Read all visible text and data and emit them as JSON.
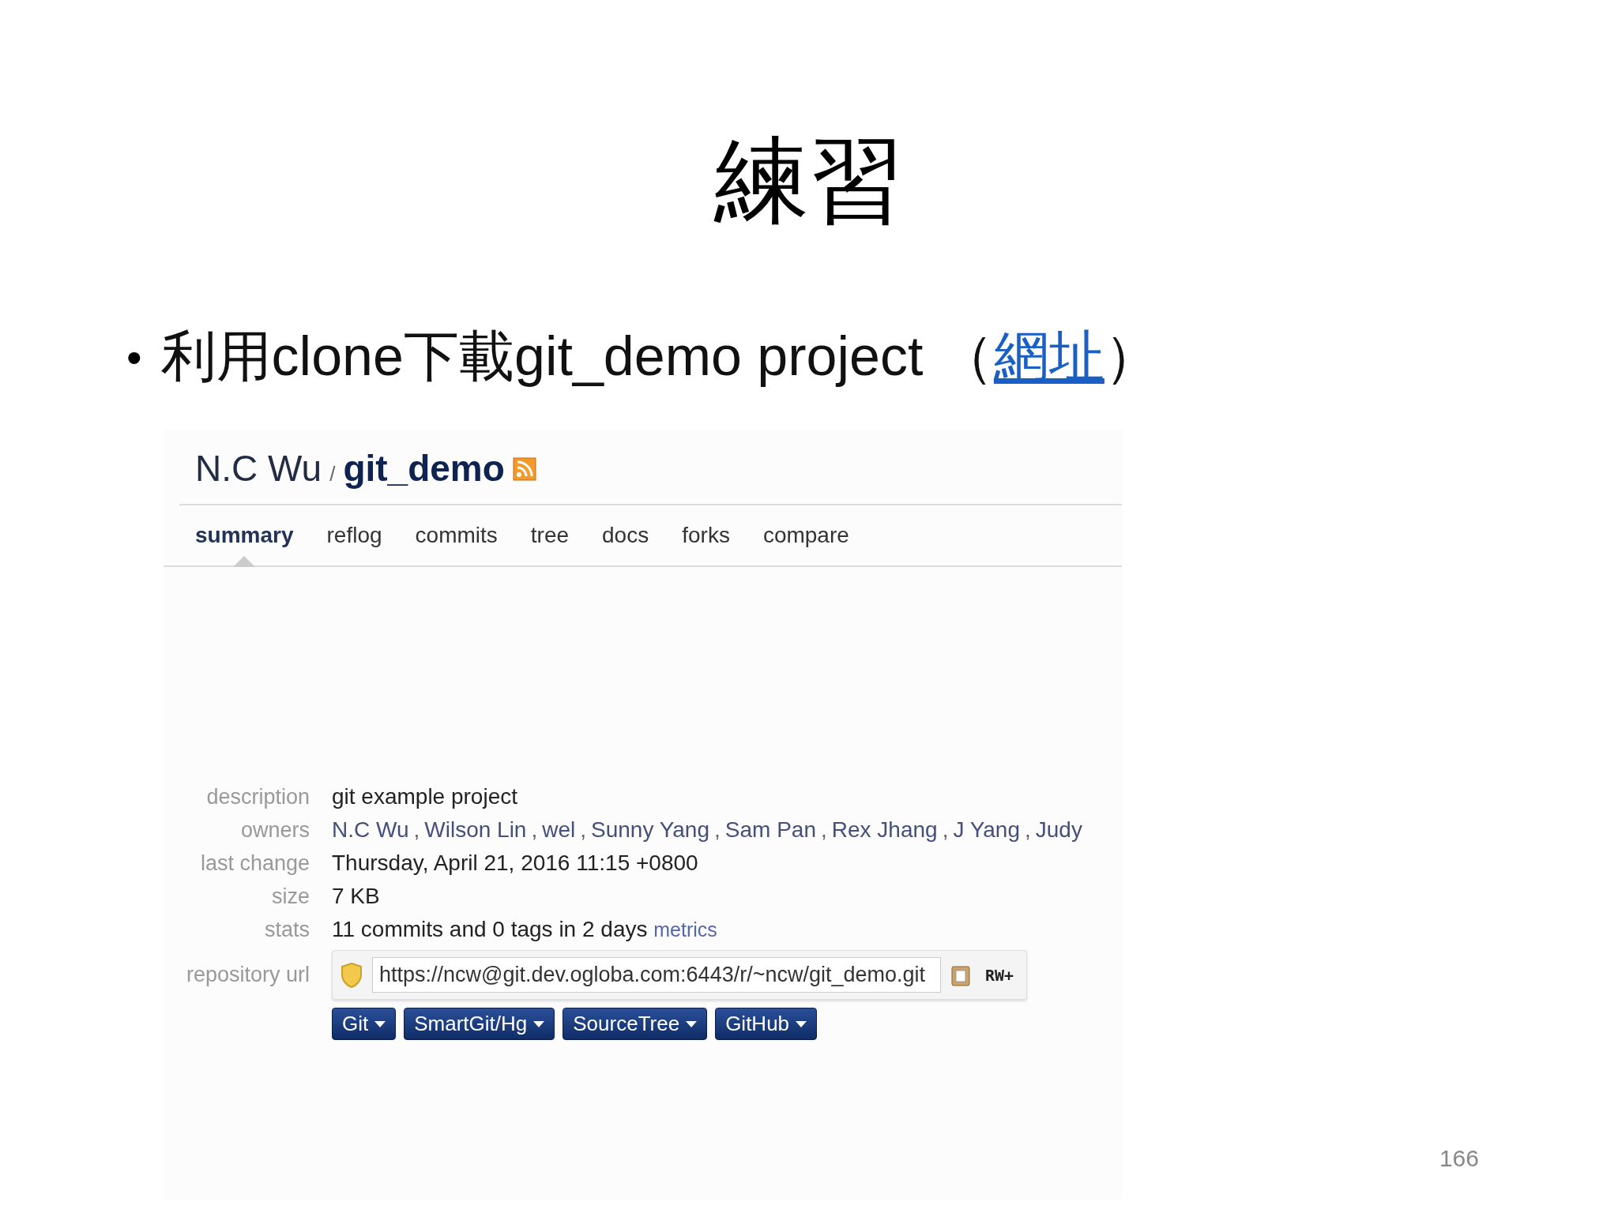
{
  "slide": {
    "title": "練習",
    "bullet": "•",
    "text_before": "利用clone下載git_demo project （",
    "link": "網址",
    "text_after": "）",
    "page_number": "166"
  },
  "repo": {
    "owner": "N.C Wu",
    "separator": "/",
    "name": "git_demo",
    "tabs": [
      {
        "label": "summary",
        "selected": true
      },
      {
        "label": "reflog",
        "selected": false
      },
      {
        "label": "commits",
        "selected": false
      },
      {
        "label": "tree",
        "selected": false
      },
      {
        "label": "docs",
        "selected": false
      },
      {
        "label": "forks",
        "selected": false
      },
      {
        "label": "compare",
        "selected": false
      }
    ],
    "fields": [
      {
        "kind": "text",
        "label": "description",
        "value": "git example project"
      },
      {
        "kind": "owners",
        "label": "owners",
        "owners": [
          {
            "name": "N.C Wu",
            "separator": ","
          },
          {
            "name": "Wilson Lin",
            "separator": ","
          },
          {
            "name": "wel",
            "separator": ","
          },
          {
            "name": "Sunny Yang",
            "separator": ","
          },
          {
            "name": "Sam Pan",
            "separator": ","
          },
          {
            "name": "Rex Jhang",
            "separator": ","
          },
          {
            "name": "J Yang",
            "separator": ","
          },
          {
            "name": "Judy"
          }
        ]
      },
      {
        "kind": "text",
        "label": "last change",
        "value": "Thursday, April 21, 2016 11:15 +0800"
      },
      {
        "kind": "text",
        "label": "size",
        "value": "7 KB"
      },
      {
        "kind": "stats",
        "label": "stats",
        "value": "11 commits and 0 tags in 2 days",
        "link": "metrics"
      },
      {
        "kind": "url",
        "label": "repository url",
        "value": "https://ncw@git.dev.ogloba.com:6443/r/~ncw/git_demo.git",
        "permission": "RW+"
      }
    ],
    "buttons": [
      "Git",
      "SmartGit/Hg",
      "SourceTree",
      "GitHub"
    ]
  }
}
